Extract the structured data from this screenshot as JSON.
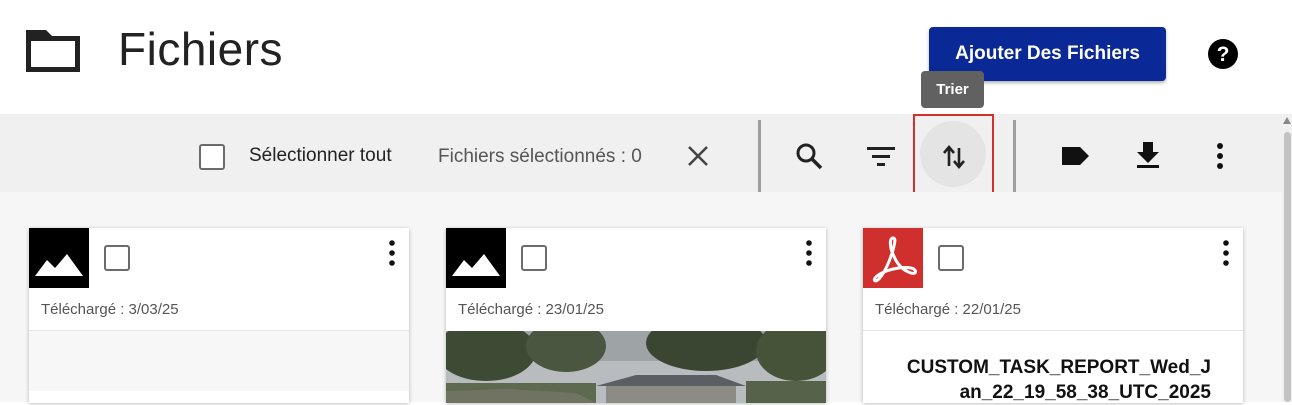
{
  "header": {
    "title": "Fichiers",
    "add_button": "Ajouter Des Fichiers",
    "folder_icon": "folder-icon",
    "help_icon": "help-icon"
  },
  "tooltip": {
    "text": "Trier"
  },
  "toolbar": {
    "select_all": "Sélectionner tout",
    "selected_count": "Fichiers sélectionnés : 0",
    "icons": [
      "close-icon",
      "search-icon",
      "filter-icon",
      "sort-icon",
      "label-icon",
      "download-icon",
      "more-vert-icon"
    ]
  },
  "files": [
    {
      "date": "Téléchargé : 3/03/25",
      "type": "image",
      "title": ""
    },
    {
      "date": "Téléchargé : 23/01/25",
      "type": "image",
      "title": ""
    },
    {
      "date": "Téléchargé : 22/01/25",
      "type": "pdf",
      "title_line1": "CUSTOM_TASK_REPORT_Wed_J",
      "title_line2": "an_22_19_58_38_UTC_2025"
    }
  ],
  "colors": {
    "primary_button": "#0a2896",
    "sort_highlight": "#d32f2f",
    "pdf_red": "#d0302d",
    "tooltip_bg": "#616161"
  }
}
